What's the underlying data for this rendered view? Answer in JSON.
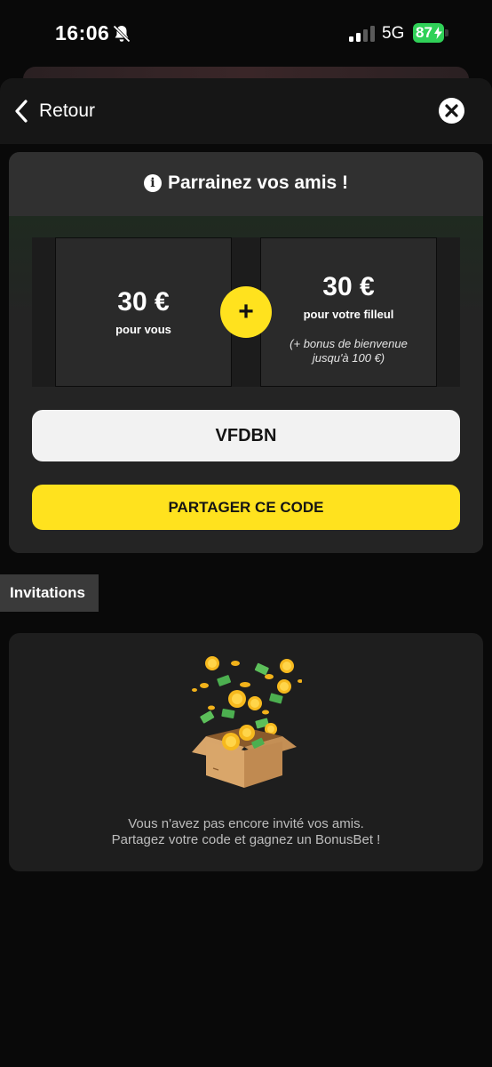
{
  "status_bar": {
    "time": "16:06",
    "network": "5G",
    "battery": "87",
    "icons": [
      "bell-muted-icon",
      "signal-icon",
      "battery-charging-icon"
    ]
  },
  "nav": {
    "back_label": "Retour",
    "back_icon": "chevron-left-icon",
    "close_icon": "close-icon"
  },
  "referral": {
    "title": "Parrainez vos amis !",
    "info_icon_glyph": "i",
    "left_amount": "30 €",
    "left_caption": "pour vous",
    "plus": "+",
    "right_amount": "30 €",
    "right_caption": "pour votre filleul",
    "right_note_line1": "(+ bonus de bienvenue",
    "right_note_line2": "jusqu'à 100 €)",
    "code": "VFDBN",
    "share_label": "PARTAGER CE CODE"
  },
  "invitations": {
    "tab_label": "Invitations",
    "empty_line1": "Vous n'avez pas encore invité vos amis.",
    "empty_line2": "Partagez votre code et gagnez un BonusBet !",
    "illustration": "gift-box-coins-icon"
  },
  "colors": {
    "accent_yellow": "#ffe21e",
    "background": "#090909",
    "card": "#262626",
    "battery_green": "#30d158"
  }
}
